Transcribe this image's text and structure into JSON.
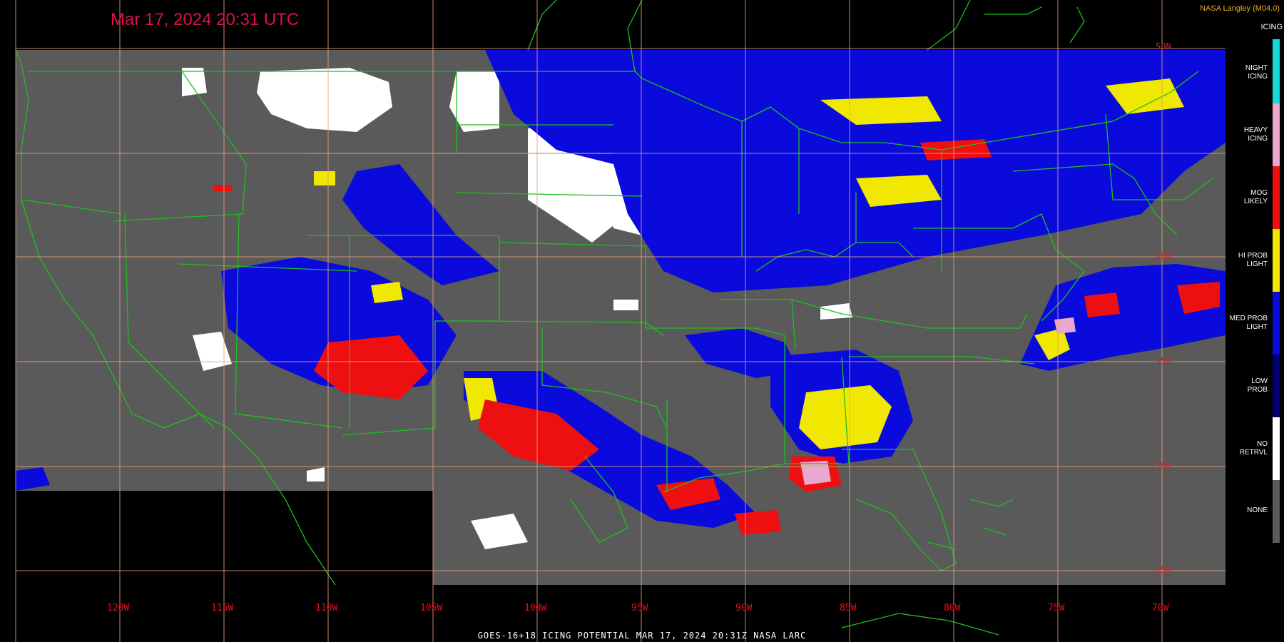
{
  "header": {
    "timestamp": "Mar 17, 2024 20:31 UTC",
    "credit": "NASA Langley (M04.0)"
  },
  "legend": {
    "title": "ICING",
    "items": [
      {
        "label": "NIGHT\nICING",
        "color": "#16d8d8"
      },
      {
        "label": "HEAVY\nICING",
        "color": "#e8a8d0"
      },
      {
        "label": "MOG\nLIKELY",
        "color": "#ee1010"
      },
      {
        "label": "HI PROB\nLIGHT",
        "color": "#f0e800"
      },
      {
        "label": "MED PROB\nLIGHT",
        "color": "#0a0adc"
      },
      {
        "label": "LOW\nPROB",
        "color": "#000070"
      },
      {
        "label": "NO\nRETRVL",
        "color": "#ffffff"
      },
      {
        "label": "NONE",
        "color": "#5a5a5a"
      }
    ]
  },
  "longitude_labels": [
    "120W",
    "115W",
    "110W",
    "105W",
    "100W",
    "95W",
    "90W",
    "85W",
    "80W",
    "75W",
    "70W"
  ],
  "latitude_labels": [
    "50N",
    "40N",
    "35N",
    "30N",
    "25N"
  ],
  "footer": {
    "text": "GOES-16+18  ICING POTENTIAL   MAR 17, 2024 20:31Z   NASA LARC"
  },
  "colors": {
    "background": "#000000",
    "data_gray": "#5a5a5a",
    "grid": "#e8a080",
    "borders": "#1fbf1f",
    "timestamp": "#e0104a"
  }
}
